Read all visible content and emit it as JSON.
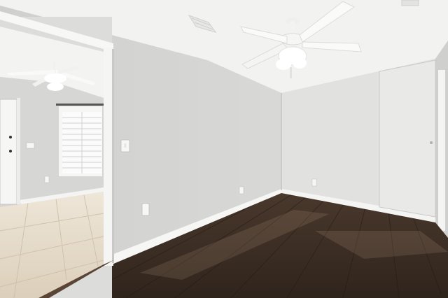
{
  "scene": {
    "kind": "empty-room-interior",
    "objects": [
      "ceiling-fan-with-light",
      "ceiling-fan-adjoining-room",
      "hvac-vent",
      "light-switch",
      "power-outlet",
      "closet-door",
      "entry-door",
      "window-with-blinds",
      "hardwood-floor",
      "tile-floor",
      "white-baseboard"
    ],
    "colors": {
      "ceiling": "#f3f3f1",
      "wall_left": "#d5d5d3",
      "wall_back": "#dcdcda",
      "wall_right": "#e4e4e2",
      "trim": "#f7f7f5",
      "floor_wood": "#3f3026",
      "floor_wood_light": "#5a4435",
      "floor_tile": "#e3d8c7",
      "room2_wall": "#d9d9d7",
      "door": "#f5f5f3"
    }
  }
}
